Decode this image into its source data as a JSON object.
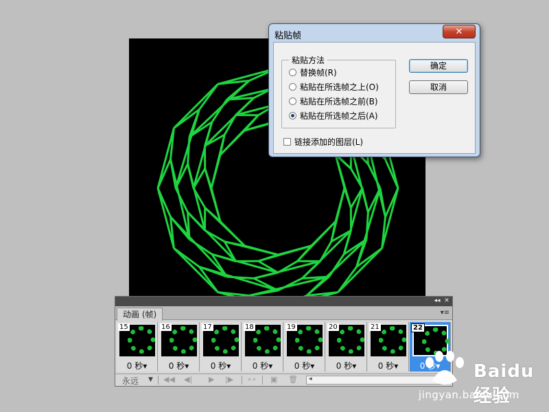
{
  "colors": {
    "canvas_bg": "#000000",
    "line_green": "#1fd440",
    "selected_frame": "#3d8ee8"
  },
  "dialog": {
    "title": "粘贴帧",
    "close_symbol": "✕",
    "group_label": "粘贴方法",
    "options": [
      {
        "label": "替换帧(R)",
        "checked": false
      },
      {
        "label": "粘贴在所选帧之上(O)",
        "checked": false
      },
      {
        "label": "粘贴在所选帧之前(B)",
        "checked": false
      },
      {
        "label": "粘贴在所选帧之后(A)",
        "checked": true
      }
    ],
    "ok_label": "确定",
    "cancel_label": "取消",
    "link_layers_label": "链接添加的图层(L)",
    "link_layers_checked": false
  },
  "anim_panel": {
    "tab_label": "动画 (帧)",
    "collapse_symbol": "◂◂",
    "close_symbol": "✕",
    "menu_symbol": "▾≡",
    "frames": [
      {
        "number": "15",
        "delay": "0 秒▾",
        "selected": false
      },
      {
        "number": "16",
        "delay": "0 秒▾",
        "selected": false
      },
      {
        "number": "17",
        "delay": "0 秒▾",
        "selected": false
      },
      {
        "number": "18",
        "delay": "0 秒▾",
        "selected": false
      },
      {
        "number": "19",
        "delay": "0 秒▾",
        "selected": false
      },
      {
        "number": "20",
        "delay": "0 秒▾",
        "selected": false
      },
      {
        "number": "21",
        "delay": "0 秒▾",
        "selected": false
      },
      {
        "number": "22",
        "delay": "0 秒▾",
        "selected": true
      }
    ],
    "loop_value": "永远",
    "controls": {
      "first_frame": "◀◀",
      "prev_frame": "◀|",
      "play": "▶",
      "next_frame": "|▶",
      "tween": "∘∘",
      "new_frame": "▣",
      "delete": "🗑",
      "scroll_left": "◂"
    }
  },
  "watermark": {
    "brand": "Baidu经验",
    "url": "jingyan.baidu.com"
  }
}
